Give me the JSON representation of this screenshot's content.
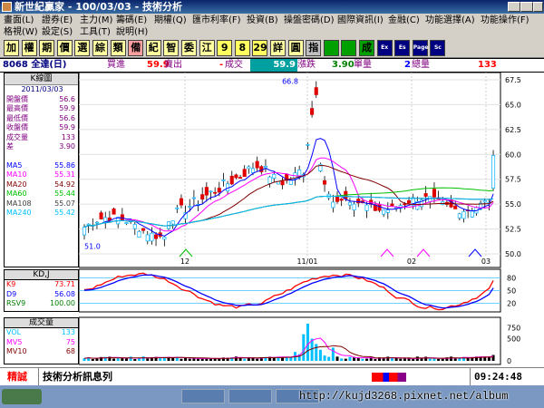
{
  "window": {
    "title": "新世紀贏家 - 100/03/03 - 技術分析"
  },
  "menu": {
    "row1": [
      "畫面(L)",
      "證券(E)",
      "主力(M)",
      "籌碼(E)",
      "期權(Q)",
      "匯市利率(F)",
      "投資(B)",
      "操盤密碼(D)",
      "國際資訊(I)",
      "金融(C)",
      "功能選擇(A)",
      "功能操作(F)"
    ],
    "row2": [
      "格視(W)",
      "設定(S)",
      "工具(T)",
      "說明(H)"
    ]
  },
  "toolbar": {
    "buttons": [
      "加",
      "權",
      "期",
      "價",
      "選",
      "綜",
      "類",
      "備",
      "紀",
      "智",
      "委",
      "江",
      "9",
      "8",
      "29",
      "詳",
      "圓",
      "指",
      "",
      "",
      "成",
      "Ex",
      "Es",
      "Page",
      "Sc"
    ]
  },
  "quote": {
    "symbol": "8068 全達(日)",
    "buy_label": "買進",
    "buy": "59.9",
    "sell_label": "賣出",
    "change": "-",
    "trade_label": "成交",
    "trade": "59.9",
    "diff_label": "漲跌",
    "diff": "3.90",
    "vol_label": "單量",
    "vol": "2",
    "total_label": "總量",
    "total": "133"
  },
  "left_panel": {
    "header": "K線圖",
    "date": "2011/03/03",
    "rows": [
      {
        "label": "開盤價",
        "value": "56.6"
      },
      {
        "label": "最高價",
        "value": "59.9"
      },
      {
        "label": "最低價",
        "value": "56.6"
      },
      {
        "label": "收盤價",
        "value": "59.9"
      },
      {
        "label": "成交量",
        "value": "133"
      },
      {
        "label": "差",
        "value": "3.90"
      }
    ],
    "ma": [
      {
        "label": "MA5",
        "value": "55.86",
        "color": "#0000ff"
      },
      {
        "label": "MA10",
        "value": "55.31",
        "color": "#ff00ff"
      },
      {
        "label": "MA20",
        "value": "54.92",
        "color": "#800000"
      },
      {
        "label": "MA60",
        "value": "55.44",
        "color": "#00c000"
      },
      {
        "label": "MA108",
        "value": "55.07",
        "color": "#404040"
      },
      {
        "label": "MA240",
        "value": "55.42",
        "color": "#00c0ff"
      }
    ]
  },
  "kd_panel": {
    "header": "KD,J",
    "rows": [
      {
        "label": "K9",
        "value": "73.71",
        "color": "#ff0000"
      },
      {
        "label": "D9",
        "value": "56.08",
        "color": "#0000ff"
      },
      {
        "label": "RSV9",
        "value": "100.00",
        "color": "#008000"
      }
    ]
  },
  "vol_panel": {
    "header": "成交量",
    "rows": [
      {
        "label": "VOL",
        "value": "133",
        "color": "#00c0ff"
      },
      {
        "label": "MV5",
        "value": "75",
        "color": "#ff00ff"
      },
      {
        "label": "MV10",
        "value": "68",
        "color": "#800000"
      }
    ]
  },
  "axes": {
    "price_ticks": [
      "67.5",
      "65.0",
      "62.5",
      "60.0",
      "57.5",
      "55.0",
      "52.5",
      "50.0"
    ],
    "kd_ticks": [
      "80",
      "50",
      "20"
    ],
    "vol_ticks": [
      "750",
      "500",
      "0"
    ],
    "x_ticks": [
      "12",
      "11/01",
      "02",
      "03"
    ],
    "high_label": "66.8",
    "low_label": "51.0"
  },
  "status": {
    "label": "精誠",
    "text": "技術分析訊息列",
    "time": "09:24:48"
  },
  "taskbar": {
    "watermark": "http://kujd3268.pixnet.net/album"
  },
  "chart_data": {
    "type": "candlestick",
    "price_range": [
      50,
      67.5
    ],
    "high_label": 66.8,
    "low_label": 51.0,
    "last_candle": {
      "open": 56.6,
      "high": 59.9,
      "low": 56.6,
      "close": 59.9
    }
  }
}
